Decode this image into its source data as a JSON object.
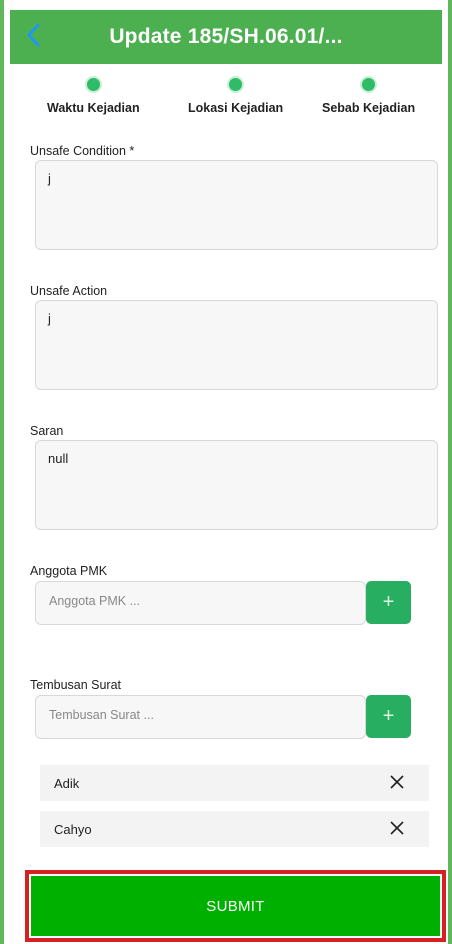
{
  "header": {
    "title": "Update 185/SH.06.01/...",
    "back_icon": "chevron-left-icon",
    "accent_color": "#4caf50"
  },
  "steps": [
    {
      "label": "Waktu Kejadian",
      "state": "done"
    },
    {
      "label": "Lokasi Kejadian",
      "state": "done"
    },
    {
      "label": "Sebab Kejadian",
      "state": "active"
    }
  ],
  "form": {
    "unsafe_condition": {
      "label": "Unsafe Condition *",
      "value": "j"
    },
    "unsafe_action": {
      "label": "Unsafe Action",
      "value": "j"
    },
    "saran": {
      "label": "Saran",
      "value": "null"
    },
    "anggota_pmk": {
      "label": "Anggota PMK",
      "placeholder": "Anggota PMK ...",
      "add_icon": "plus-icon"
    },
    "tembusan_surat": {
      "label": "Tembusan Surat",
      "placeholder": "Tembusan Surat ...",
      "add_icon": "plus-icon"
    },
    "tembusan_list": [
      {
        "name": "Adik",
        "remove_icon": "close-icon"
      },
      {
        "name": "Cahyo",
        "remove_icon": "close-icon"
      }
    ]
  },
  "submit": {
    "label": "SUBMIT",
    "color": "#00b000",
    "highlight_color": "#d42222"
  }
}
